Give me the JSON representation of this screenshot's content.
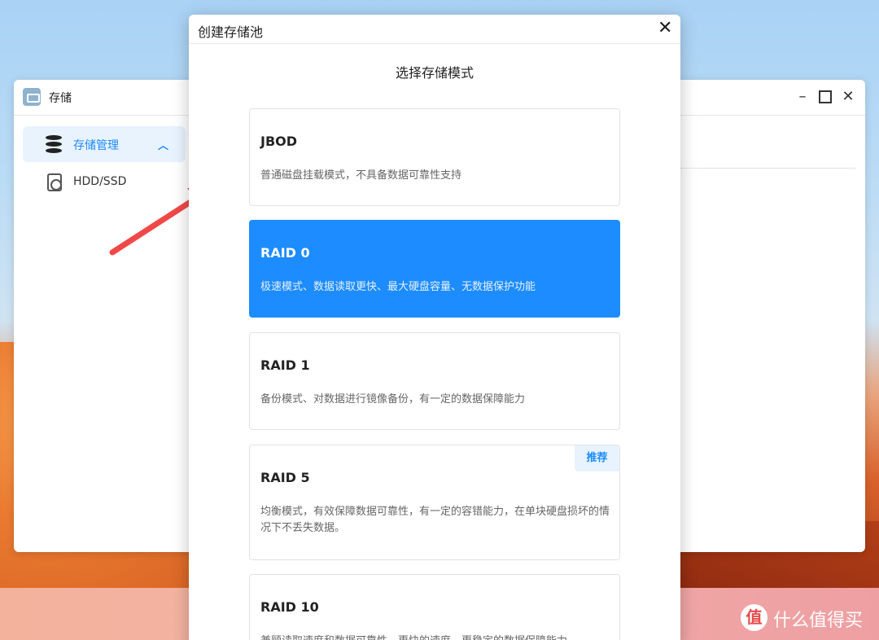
{
  "background_window": {
    "app_title": "存储",
    "sidebar": {
      "items": [
        {
          "label": "存储管理",
          "icon": "database-icon",
          "active": true,
          "expanded": true
        },
        {
          "label": "HDD/SSD",
          "icon": "hdd-icon",
          "active": false
        }
      ]
    },
    "controls": {
      "minimize": "–",
      "close": "✕"
    }
  },
  "modal": {
    "title": "创建存储池",
    "close": "✕",
    "subtitle": "选择存储模式",
    "options": [
      {
        "title": "JBOD",
        "description": "普通磁盘挂载模式，不具备数据可靠性支持",
        "selected": false
      },
      {
        "title": "RAID 0",
        "description": "极速模式、数据读取更快、最大硬盘容量、无数据保护功能",
        "selected": true
      },
      {
        "title": "RAID 1",
        "description": "备份模式、对数据进行镜像备份，有一定的数据保障能力",
        "selected": false
      },
      {
        "title": "RAID 5",
        "description": "均衡模式，有效保障数据可靠性，有一定的容错能力，在单块硬盘损坏的情况下不丢失数据。",
        "badge": "推荐",
        "selected": false
      },
      {
        "title": "RAID 10",
        "description": "兼顾读取速度和数据可靠性，更快的速度，更稳定的数据保障能力",
        "selected": false
      }
    ]
  },
  "colors": {
    "accent": "#1c8cff",
    "arrow": "#f04848"
  },
  "watermark": {
    "logo": "值",
    "text": "什么值得买"
  }
}
